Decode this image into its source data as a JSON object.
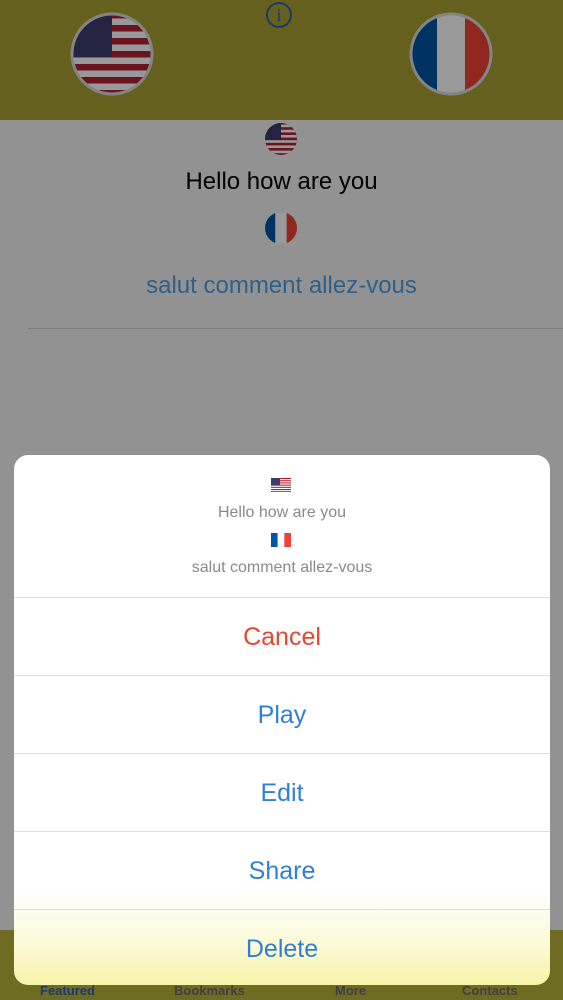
{
  "header": {
    "source_flag": "us-flag-icon",
    "target_flag": "france-flag-icon",
    "info_glyph": "i"
  },
  "translation": {
    "source_text": "Hello how are you",
    "target_text": "salut comment allez-vous"
  },
  "tabs": [
    "Featured",
    "Bookmarks",
    "More",
    "Contacts"
  ],
  "action_sheet": {
    "source_text": "Hello how are you",
    "target_text": "salut comment allez-vous",
    "actions": [
      "Cancel",
      "Play",
      "Edit",
      "Share",
      "Delete"
    ]
  },
  "colors": {
    "header_bg": "#a8a131",
    "action_blue": "#2f7fd6",
    "cancel_red": "#e8452f",
    "target_text_blue": "#4ea0e6"
  }
}
